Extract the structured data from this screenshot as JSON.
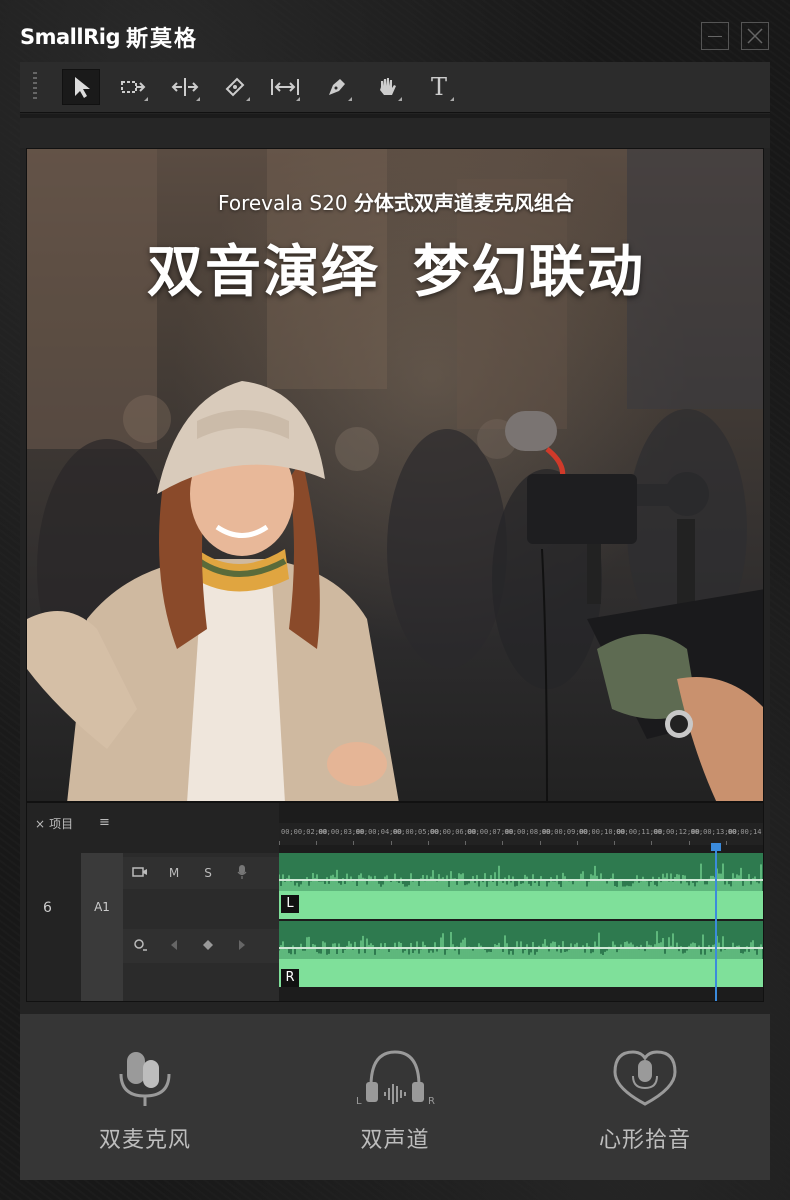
{
  "brand": {
    "name_en": "SmallRig",
    "name_cn": "斯莫格"
  },
  "window": {
    "minimize_icon": "minimize-icon",
    "close_icon": "close-icon"
  },
  "toolbar": {
    "tools": [
      {
        "name": "selection-tool",
        "icon": "arrow-cursor-icon",
        "active": true
      },
      {
        "name": "track-select-tool",
        "icon": "track-select-icon",
        "active": false
      },
      {
        "name": "ripple-edit-tool",
        "icon": "ripple-edit-icon",
        "active": false
      },
      {
        "name": "razor-tool",
        "icon": "razor-icon",
        "active": false
      },
      {
        "name": "slip-tool",
        "icon": "slip-icon",
        "active": false
      },
      {
        "name": "pen-tool",
        "icon": "pen-icon",
        "active": false
      },
      {
        "name": "hand-tool",
        "icon": "hand-icon",
        "active": false
      },
      {
        "name": "type-tool",
        "icon": "type-icon",
        "active": false
      }
    ],
    "type_tool_label": "T"
  },
  "preview": {
    "subtitle_product": "Forevala S20",
    "subtitle_desc": "分体式双声道麦克风组合",
    "headline_part1": "双音演绎",
    "headline_part2": "梦幻联动"
  },
  "timeline": {
    "tab_close": "×",
    "tab_label": "项目",
    "menu_icon": "≡",
    "lock_glyph": "6",
    "track_name": "A1",
    "track_controls": [
      "M",
      "S"
    ],
    "channels": {
      "left": "L",
      "right": "R"
    },
    "ruler_ticks": [
      "00;00;02;00",
      "00;00;03;00",
      "00;00;04;00",
      "00;00;05;00",
      "00;00;06;00",
      "00;00;07;00",
      "00;00;08;00",
      "00;00;09;00",
      "00;00;10;00",
      "00;00;11;00",
      "00;00;12;00",
      "00;00;13;00",
      "00;00;14;00"
    ],
    "playhead_fraction": 0.9,
    "colors": {
      "waveform": "#7fe09a",
      "track": "#2e7a4f",
      "playhead": "#3b8bdc"
    }
  },
  "features": [
    {
      "label": "双麦克风",
      "icon": "dual-microphone-icon"
    },
    {
      "label": "双声道",
      "icon": "stereo-headphones-icon",
      "left": "L",
      "right": "R"
    },
    {
      "label": "心形拾音",
      "icon": "cardioid-pickup-icon"
    }
  ]
}
